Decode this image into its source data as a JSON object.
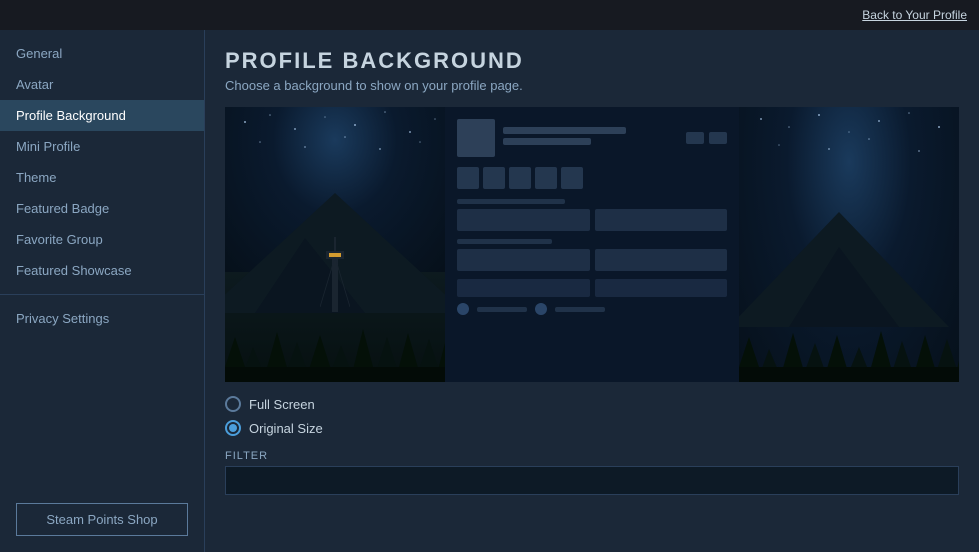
{
  "topbar": {
    "back_link": "Back to Your Profile"
  },
  "sidebar": {
    "items": [
      {
        "id": "general",
        "label": "General",
        "active": false
      },
      {
        "id": "avatar",
        "label": "Avatar",
        "active": false
      },
      {
        "id": "profile-background",
        "label": "Profile Background",
        "active": true
      },
      {
        "id": "mini-profile",
        "label": "Mini Profile",
        "active": false
      },
      {
        "id": "theme",
        "label": "Theme",
        "active": false
      },
      {
        "id": "featured-badge",
        "label": "Featured Badge",
        "active": false
      },
      {
        "id": "favorite-group",
        "label": "Favorite Group",
        "active": false
      },
      {
        "id": "featured-showcase",
        "label": "Featured Showcase",
        "active": false
      }
    ],
    "divider_after": [
      "theme",
      "featured-showcase"
    ],
    "privacy_label": "Privacy Settings",
    "points_shop_label": "Steam Points Shop"
  },
  "content": {
    "title": "PROFILE BACKGROUND",
    "subtitle": "Choose a background to show on your profile page.",
    "radio_options": [
      {
        "id": "full-screen",
        "label": "Full Screen",
        "selected": false
      },
      {
        "id": "original-size",
        "label": "Original Size",
        "selected": true
      }
    ],
    "filter_label": "FILTER",
    "filter_placeholder": ""
  }
}
